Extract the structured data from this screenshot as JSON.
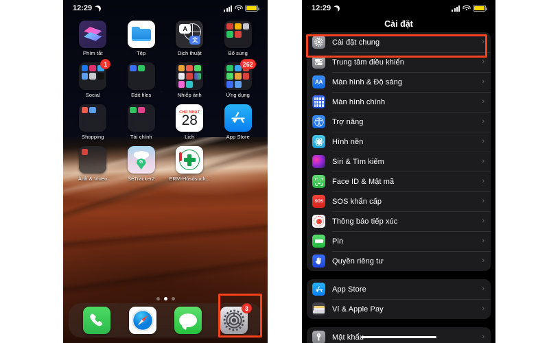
{
  "home_screen": {
    "status_bar": {
      "time": "12:29",
      "moon_icon": "crescent-moon-icon",
      "signal_icon": "cellular-bars-icon",
      "wifi_icon": "wifi-icon",
      "battery_icon": "battery-icon",
      "battery_color": "#f5d800"
    },
    "apps": [
      {
        "label": "Phím tắt",
        "icon": "shortcuts-icon",
        "badge": ""
      },
      {
        "label": "Tệp",
        "icon": "files-icon",
        "badge": ""
      },
      {
        "label": "Dịch thuật",
        "icon": "translate-icon",
        "badge": ""
      },
      {
        "label": "Bổ sung",
        "icon": "folder-icon",
        "badge": ""
      },
      {
        "label": "Social",
        "icon": "folder-icon",
        "badge": "1"
      },
      {
        "label": "Edit files",
        "icon": "folder-icon",
        "badge": ""
      },
      {
        "label": "Nhiếp ảnh",
        "icon": "folder-icon",
        "badge": ""
      },
      {
        "label": "Ứng dụng",
        "icon": "folder-icon",
        "badge": "262"
      },
      {
        "label": "Shopping",
        "icon": "folder-icon",
        "badge": ""
      },
      {
        "label": "Tài chính",
        "icon": "folder-icon",
        "badge": ""
      },
      {
        "label": "Lịch",
        "icon": "calendar-icon",
        "badge": ""
      },
      {
        "label": "App Store",
        "icon": "app-store-icon",
        "badge": ""
      },
      {
        "label": "Ảnh & Video",
        "icon": "folder-icon",
        "badge": ""
      },
      {
        "label": "SeTracker2",
        "icon": "setracker-icon",
        "badge": ""
      },
      {
        "label": "ERM-Hósdsuck...",
        "icon": "erm-icon",
        "badge": ""
      }
    ],
    "calendar_icon": {
      "weekday": "CHỦ NHẬT",
      "day": "28"
    },
    "page_dots": {
      "count": 3,
      "active_index": 1
    },
    "dock": [
      {
        "name": "phone-app",
        "icon": "phone-icon",
        "badge": ""
      },
      {
        "name": "safari-app",
        "icon": "safari-compass-icon",
        "badge": ""
      },
      {
        "name": "messages-app",
        "icon": "messages-bubble-icon",
        "badge": ""
      },
      {
        "name": "settings-app",
        "icon": "settings-gear-icon",
        "badge": "3"
      }
    ],
    "highlight_color": "#f5421c"
  },
  "settings_screen": {
    "status_bar": {
      "time": "12:29",
      "moon_icon": "crescent-moon-icon",
      "signal_icon": "cellular-bars-icon",
      "wifi_icon": "wifi-icon",
      "battery_icon": "battery-icon"
    },
    "title": "Cài đặt",
    "chevron": "›",
    "highlight_color": "#f5421c",
    "groups": [
      {
        "rows": [
          {
            "label": "Cài đặt chung",
            "icon": "general-gear-icon",
            "highlighted": true
          },
          {
            "label": "Trung tâm điều khiển",
            "icon": "control-center-icon",
            "highlighted": false
          },
          {
            "label": "Màn hình & Độ sáng",
            "icon": "display-brightness-icon",
            "highlighted": false
          },
          {
            "label": "Màn hình chính",
            "icon": "home-screen-icon",
            "highlighted": false
          },
          {
            "label": "Trợ năng",
            "icon": "accessibility-icon",
            "highlighted": false
          },
          {
            "label": "Hình nền",
            "icon": "wallpaper-icon",
            "highlighted": false
          },
          {
            "label": "Siri & Tìm kiếm",
            "icon": "siri-icon",
            "highlighted": false
          },
          {
            "label": "Face ID & Mật mã",
            "icon": "face-id-icon",
            "highlighted": false
          },
          {
            "label": "SOS khẩn cấp",
            "icon": "sos-icon",
            "highlighted": false
          },
          {
            "label": "Thông báo tiếp xúc",
            "icon": "exposure-notification-icon",
            "highlighted": false
          },
          {
            "label": "Pin",
            "icon": "battery-icon",
            "highlighted": false
          },
          {
            "label": "Quyền riêng tư",
            "icon": "privacy-hand-icon",
            "highlighted": false
          }
        ]
      },
      {
        "rows": [
          {
            "label": "App Store",
            "icon": "app-store-icon",
            "highlighted": false
          },
          {
            "label": "Ví & Apple Pay",
            "icon": "wallet-icon",
            "highlighted": false
          }
        ]
      },
      {
        "rows": [
          {
            "label": "Mật khẩu",
            "icon": "password-key-icon",
            "highlighted": false
          }
        ]
      }
    ],
    "sos_icon_text": "SOS",
    "display_icon_text": "AA"
  }
}
